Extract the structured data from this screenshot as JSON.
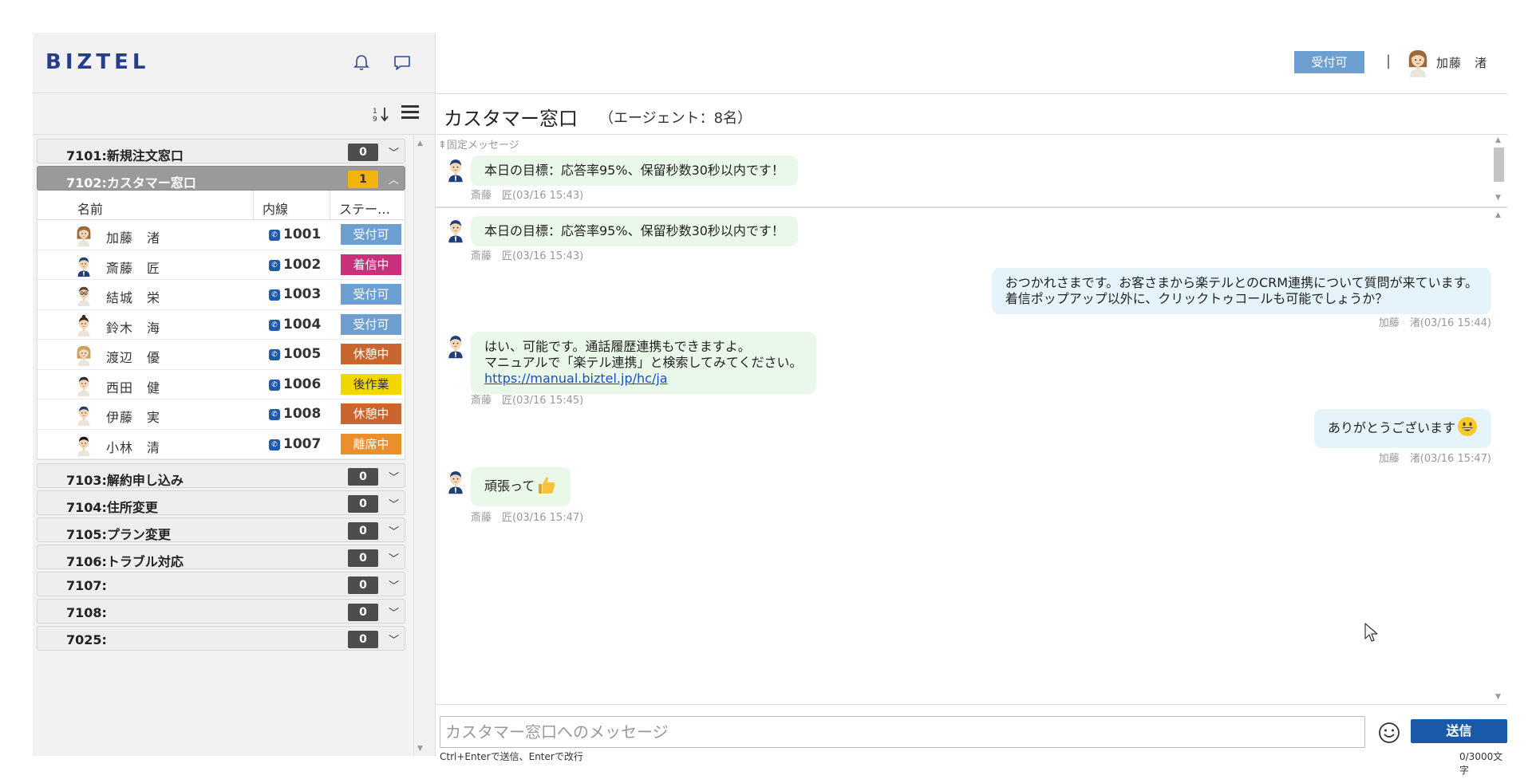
{
  "sidebar": {
    "logo": "BIZTEL",
    "queues_top": [
      {
        "name": "7101:新規注文窓口",
        "count": "0"
      },
      {
        "name": "7102:カスタマー窓口",
        "count": "1",
        "active": true
      }
    ],
    "agent_columns": [
      "名前",
      "内線",
      "ステー…"
    ],
    "agents": [
      {
        "name": "加藤　渚",
        "ext": "1001",
        "status": "受付可",
        "status_color": "#6d9fd1",
        "avatar": "woman-brown"
      },
      {
        "name": "斎藤　匠",
        "ext": "1002",
        "status": "着信中",
        "status_color": "#c8307b",
        "avatar": "man-blue"
      },
      {
        "name": "結城　栄",
        "ext": "1003",
        "status": "受付可",
        "status_color": "#6d9fd1",
        "avatar": "man-glasses"
      },
      {
        "name": "鈴木　海",
        "ext": "1004",
        "status": "受付可",
        "status_color": "#6d9fd1",
        "avatar": "woman-dark"
      },
      {
        "name": "渡辺　優",
        "ext": "1005",
        "status": "休憩中",
        "status_color": "#c9652f",
        "avatar": "woman-blonde"
      },
      {
        "name": "西田　健",
        "ext": "1006",
        "status": "後作業",
        "status_color": "#f2d600",
        "status_text_color": "#333333",
        "avatar": "man-dark"
      },
      {
        "name": "伊藤　実",
        "ext": "1008",
        "status": "休憩中",
        "status_color": "#c9652f",
        "avatar": "man-navy"
      },
      {
        "name": "小林　清",
        "ext": "1007",
        "status": "離席中",
        "status_color": "#ea8f2b",
        "avatar": "man-black"
      }
    ],
    "queues_bottom": [
      {
        "name": "7103:解約申し込み",
        "count": "0"
      },
      {
        "name": "7104:住所変更",
        "count": "0"
      },
      {
        "name": "7105:プラン変更",
        "count": "0"
      },
      {
        "name": "7106:トラブル対応",
        "count": "0"
      },
      {
        "name": "7107:",
        "count": "0"
      },
      {
        "name": "7108:",
        "count": "0"
      },
      {
        "name": "7025:",
        "count": "0"
      }
    ]
  },
  "header": {
    "status_label": "受付可",
    "divider": "|",
    "user_name": "加藤　渚"
  },
  "channel": {
    "title": "カスタマー窓口",
    "subtitle": "（エージェント：8名）"
  },
  "pinned": {
    "label": "固定メッセージ",
    "text": "本日の目標：応答率95%、保留秒数30秒以内です！",
    "meta": "斎藤　匠(03/16 15:43)"
  },
  "messages": [
    {
      "side": "left",
      "lines": [
        "本日の目標：応答率95%、保留秒数30秒以内です！"
      ],
      "meta": "斎藤　匠(03/16 15:43)"
    },
    {
      "side": "right",
      "lines": [
        "おつかれさまです。お客さまから楽テルとのCRM連携について質問が来ています。",
        "着信ポップアップ以外に、クリックトゥコールも可能でしょうか？"
      ],
      "meta": "加藤　渚(03/16 15:44)"
    },
    {
      "side": "left",
      "lines": [
        "はい、可能です。通話履歴連携もできますよ。",
        "マニュアルで「楽テル連携」と検索してみてください。"
      ],
      "link": "https://manual.biztel.jp/hc/ja",
      "meta": "斎藤　匠(03/16 15:45)"
    },
    {
      "side": "right",
      "lines": [
        "ありがとうございます"
      ],
      "emoji": "grin",
      "meta": "加藤　渚(03/16 15:47)"
    },
    {
      "side": "left",
      "lines": [
        "頑張って"
      ],
      "emoji": "thumbs-up",
      "meta": "斎藤　匠(03/16 15:47)"
    }
  ],
  "composer": {
    "placeholder": "カスタマー窓口へのメッセージ",
    "send_label": "送信",
    "hint": "Ctrl+Enterで送信、Enterで改行",
    "char_count": "0/3000文字"
  }
}
